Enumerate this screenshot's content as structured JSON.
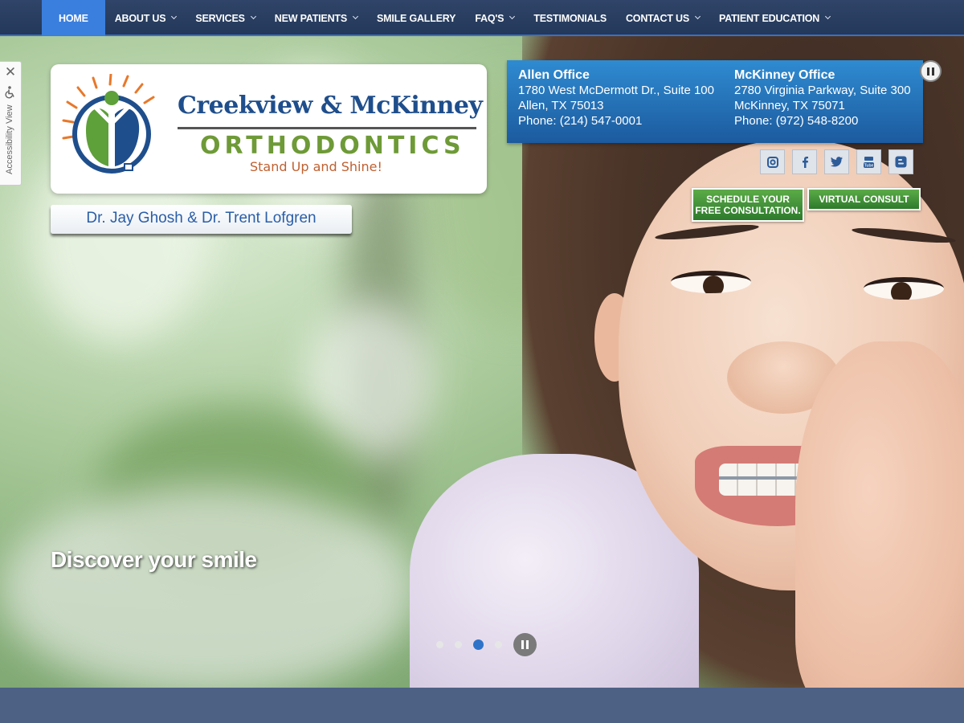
{
  "nav": {
    "items": [
      {
        "label": "HOME",
        "dropdown": false,
        "active": true
      },
      {
        "label": "ABOUT US",
        "dropdown": true
      },
      {
        "label": "SERVICES",
        "dropdown": true
      },
      {
        "label": "NEW PATIENTS",
        "dropdown": true
      },
      {
        "label": "SMILE GALLERY",
        "dropdown": false
      },
      {
        "label": "FAQ'S",
        "dropdown": true
      },
      {
        "label": "TESTIMONIALS",
        "dropdown": false
      },
      {
        "label": "CONTACT US",
        "dropdown": true
      },
      {
        "label": "PATIENT EDUCATION",
        "dropdown": true
      }
    ]
  },
  "logo": {
    "line1": "Creekview & McKinney",
    "line2": "ORTHODONTICS",
    "tagline": "Stand Up and Shine!"
  },
  "doctors": "Dr. Jay Ghosh & Dr. Trent Lofgren",
  "offices": [
    {
      "name": "Allen Office",
      "street": "1780 West McDermott Dr., Suite 100",
      "city": "Allen, TX 75013",
      "phone": "Phone: (214) 547-0001"
    },
    {
      "name": "McKinney Office",
      "street": "2780 Virginia Parkway, Suite 300",
      "city": "McKinney, TX 75071",
      "phone": "Phone: (972) 548-8200"
    }
  ],
  "social": [
    "instagram-icon",
    "facebook-icon",
    "twitter-icon",
    "youtube-icon",
    "blogger-icon"
  ],
  "cta": {
    "schedule_line1": "SCHEDULE YOUR",
    "schedule_line2": "FREE CONSULTATION.",
    "virtual": "VIRTUAL CONSULT"
  },
  "accessibility": {
    "label": "Accessibility View",
    "close": "✕"
  },
  "slider": {
    "caption": "Discover your smile",
    "total_slides": 4,
    "active_slide": 3
  },
  "colors": {
    "nav_bg": "#2f4468",
    "active_nav": "#3a7fde",
    "office_box": "#1c5a9e",
    "cta_green": "#3d8b37",
    "logo_blue": "#1f4e8c",
    "logo_green": "#6e9a37"
  }
}
